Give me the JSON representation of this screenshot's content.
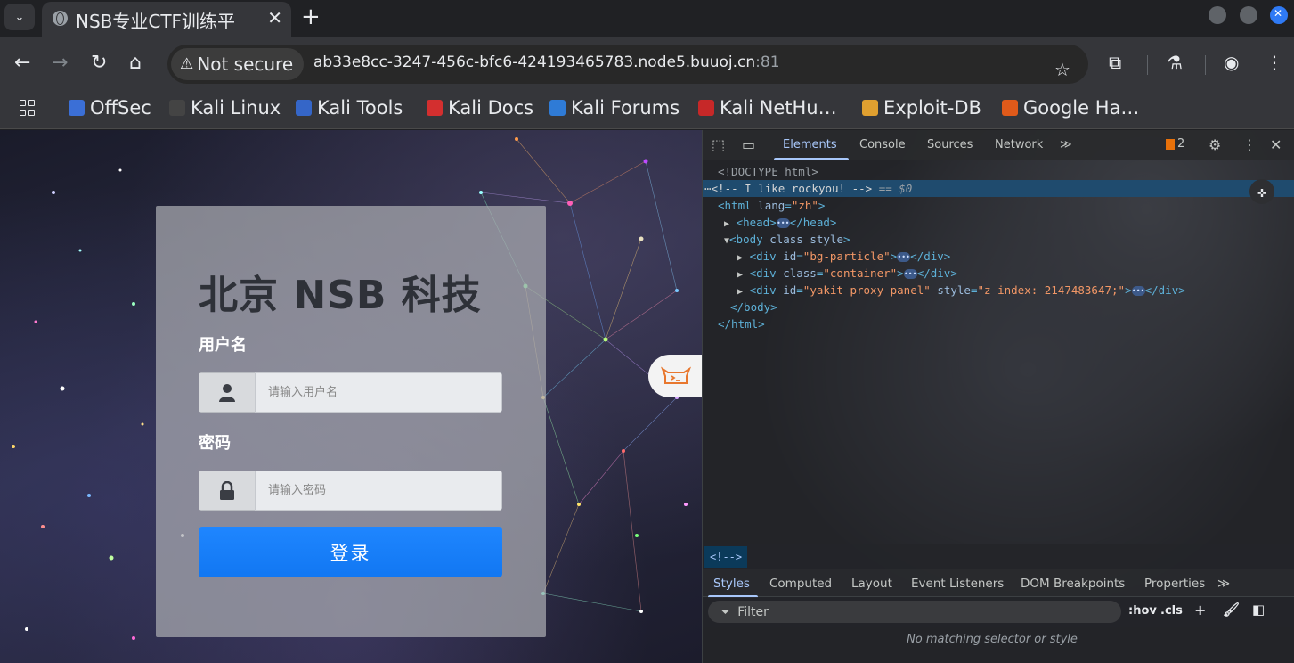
{
  "browser": {
    "tab_title": "NSB专业CTF训练平",
    "new_tab": "+",
    "security_label": "Not secure",
    "url_main": "ab33e8cc-3247-456c-bfc6-424193465783.node5.buuoj.cn",
    "url_port": ":81"
  },
  "bookmarks": [
    {
      "label": "OffSec",
      "color": "#3b6fd6"
    },
    {
      "label": "Kali Linux",
      "color": "#444444"
    },
    {
      "label": "Kali Tools",
      "color": "#3566c8"
    },
    {
      "label": "Kali Docs",
      "color": "#d32f2f"
    },
    {
      "label": "Kali Forums",
      "color": "#2f7bd6"
    },
    {
      "label": "Kali NetHu…",
      "color": "#c62828"
    },
    {
      "label": "Exploit-DB",
      "color": "#e0a030"
    },
    {
      "label": "Google Ha…",
      "color": "#e05a1a"
    }
  ],
  "login": {
    "title": "北京 NSB 科技",
    "username_label": "用户名",
    "username_placeholder": "请输入用户名",
    "password_label": "密码",
    "password_placeholder": "请输入密码",
    "submit_label": "登录"
  },
  "devtools": {
    "tabs": [
      "Elements",
      "Console",
      "Sources",
      "Network"
    ],
    "more": "≫",
    "issues_count": "2",
    "dom": {
      "doctype": "<!DOCTYPE html>",
      "comment": "<!-- I like rockyou! -->",
      "comment_ref": "== $0",
      "html_open": "<html",
      "html_lang_attr": "lang",
      "html_lang_val": "\"zh\"",
      "head_open": "<head>",
      "head_close": "</head>",
      "body_open": "<body",
      "body_attrs": "class style",
      "div1_id": "\"bg-particle\"",
      "div2_class": "\"container\"",
      "div3_id": "\"yakit-proxy-panel\"",
      "div3_style": "\"z-index: 2147483647;\"",
      "body_close": "</body>",
      "html_close": "</html>"
    },
    "breadcrumb": "<!-->",
    "style_tabs": [
      "Styles",
      "Computed",
      "Layout",
      "Event Listeners",
      "DOM Breakpoints",
      "Properties"
    ],
    "filter_placeholder": "Filter",
    "hov": ":hov",
    "cls": ".cls",
    "no_match": "No matching selector or style"
  }
}
